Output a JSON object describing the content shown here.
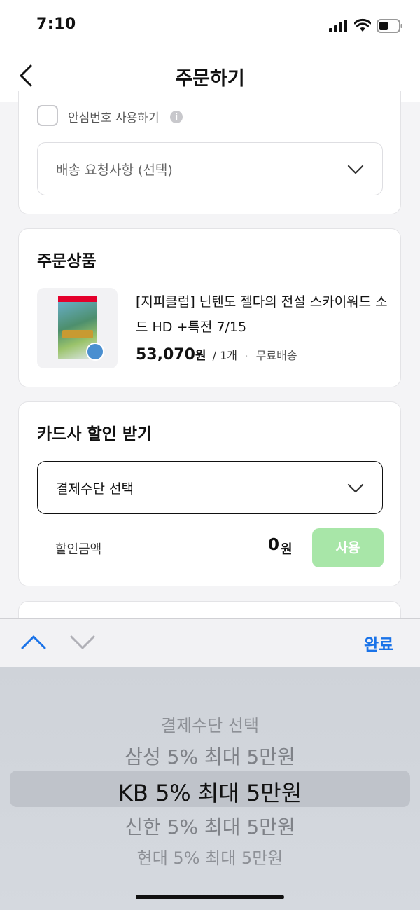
{
  "status_bar": {
    "time": "7:10"
  },
  "nav": {
    "title": "주문하기"
  },
  "delivery": {
    "safe_number_label": "안심번호 사용하기",
    "request_placeholder": "배송 요청사항 (선택)"
  },
  "order_items": {
    "section_title": "주문상품",
    "product_name": "[지피클럽] 닌텐도 젤다의 전설 스카이워드 소드 HD +특전 7/15",
    "price": "53,070",
    "price_unit": "원",
    "quantity": "/ 1개",
    "dot": "·",
    "shipping": "무료배송"
  },
  "card_discount": {
    "section_title": "카드사 할인 받기",
    "payment_select": "결제수단 선택",
    "discount_label": "할인금액",
    "discount_amount": "0",
    "discount_unit": "원",
    "use_button": "사용"
  },
  "accessory": {
    "done_label": "완료"
  },
  "picker": {
    "options": [
      "결제수단 선택",
      "삼성 5% 최대 5만원",
      "KB 5% 최대 5만원",
      "신한 5% 최대 5만원",
      "현대 5% 최대 5만원"
    ],
    "selected_index": 2
  },
  "colors": {
    "accent": "#1a73e8",
    "use_button": "#a8e6a8"
  }
}
